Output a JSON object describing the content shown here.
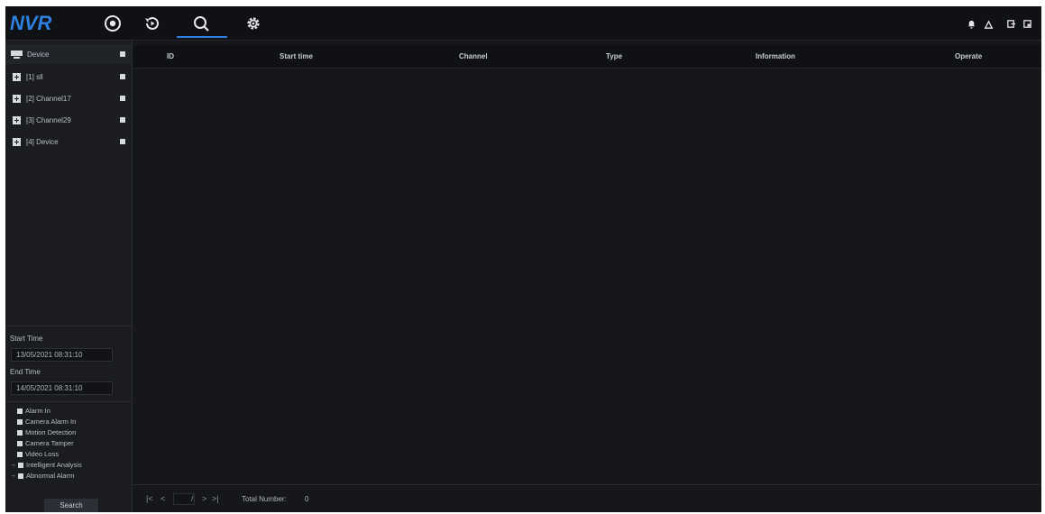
{
  "app": {
    "logo": "NVR"
  },
  "nav": {
    "items": [
      {
        "name": "live-view-icon"
      },
      {
        "name": "playback-icon"
      },
      {
        "name": "search-icon"
      },
      {
        "name": "settings-icon"
      }
    ],
    "active": "search-icon"
  },
  "topright": [
    "bell-icon",
    "user-icon",
    "logout-icon",
    "lock-icon"
  ],
  "tree": {
    "root": "Device",
    "items": [
      {
        "label": "[1] sll"
      },
      {
        "label": "[2] Channel17"
      },
      {
        "label": "[3] Channel29"
      },
      {
        "label": "[4] Device"
      }
    ]
  },
  "filters": {
    "start_label": "Start Time",
    "start_value": "13/05/2021 08:31:10",
    "end_label": "End Time",
    "end_value": "14/05/2021 08:31:10"
  },
  "types": [
    {
      "label": "Alarm In",
      "expand": false
    },
    {
      "label": "Camera Alarm In",
      "expand": false
    },
    {
      "label": "Motion Detection",
      "expand": false
    },
    {
      "label": "Camera Tamper",
      "expand": false
    },
    {
      "label": "Video Loss",
      "expand": false
    },
    {
      "label": "Intelligent Analysis",
      "expand": true
    },
    {
      "label": "Abnormal Alarm",
      "expand": true
    }
  ],
  "search_label": "Search",
  "table": {
    "columns": [
      "ID",
      "Start time",
      "Channel",
      "Type",
      "Information",
      "Operate"
    ]
  },
  "pager": {
    "first": "|<",
    "prev": "<",
    "page_sep": "/",
    "next": ">",
    "last": ">|",
    "total_label": "Total Number:",
    "total_value": "0"
  },
  "colors": {
    "accent": "#2f7fe0",
    "background": "#15171b",
    "topbar": "#0f1114"
  }
}
